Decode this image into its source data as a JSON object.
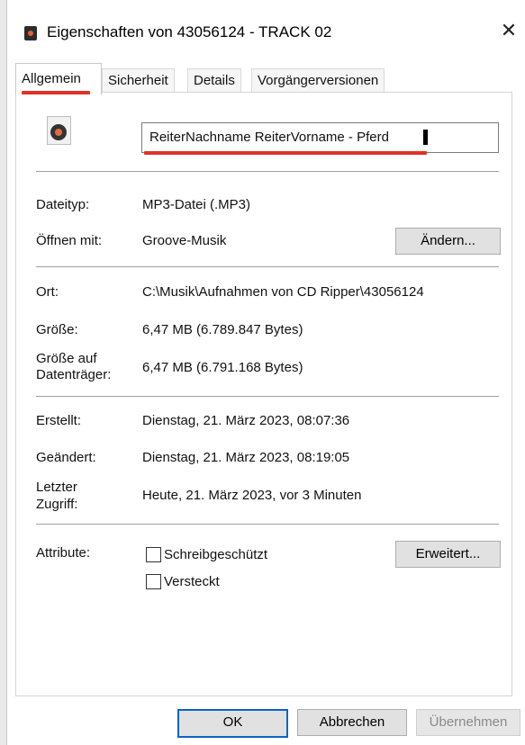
{
  "window": {
    "title": "Eigenschaften von 43056124 - TRACK 02",
    "close_glyph": "✕"
  },
  "tabs": [
    "Allgemein",
    "Sicherheit",
    "Details",
    "Vorgängerversionen"
  ],
  "general": {
    "file_name": "ReiterNachname ReiterVorname - Pferd",
    "file_type_label": "Dateityp:",
    "file_type_value": "MP3-Datei (.MP3)",
    "open_with_label": "Öffnen mit:",
    "open_with_value": "Groove-Musik",
    "change_button": "Ändern...",
    "location_label": "Ort:",
    "location_value": "C:\\Musik\\Aufnahmen von CD Ripper\\43056124",
    "size_label": "Größe:",
    "size_value": "6,47 MB (6.789.847 Bytes)",
    "size_on_disk_label_1": "Größe auf",
    "size_on_disk_label_2": "Datenträger:",
    "size_on_disk_value": "6,47 MB (6.791.168 Bytes)",
    "created_label": "Erstellt:",
    "created_value": "Dienstag, 21. März 2023, 08:07:36",
    "modified_label": "Geändert:",
    "modified_value": "Dienstag, 21. März 2023, 08:19:05",
    "accessed_label_1": "Letzter",
    "accessed_label_2": "Zugriff:",
    "accessed_value": "Heute, 21. März 2023, vor 3 Minuten",
    "attributes_label": "Attribute:",
    "readonly_label": "Schreibgeschützt",
    "readonly_checked": false,
    "hidden_label": "Versteckt",
    "hidden_checked": false,
    "advanced_button": "Erweitert..."
  },
  "footer": {
    "ok": "OK",
    "cancel": "Abbrechen",
    "apply": "Übernehmen"
  },
  "colors": {
    "highlight_red": "#e0322a",
    "focus_blue": "#0a64c8"
  }
}
